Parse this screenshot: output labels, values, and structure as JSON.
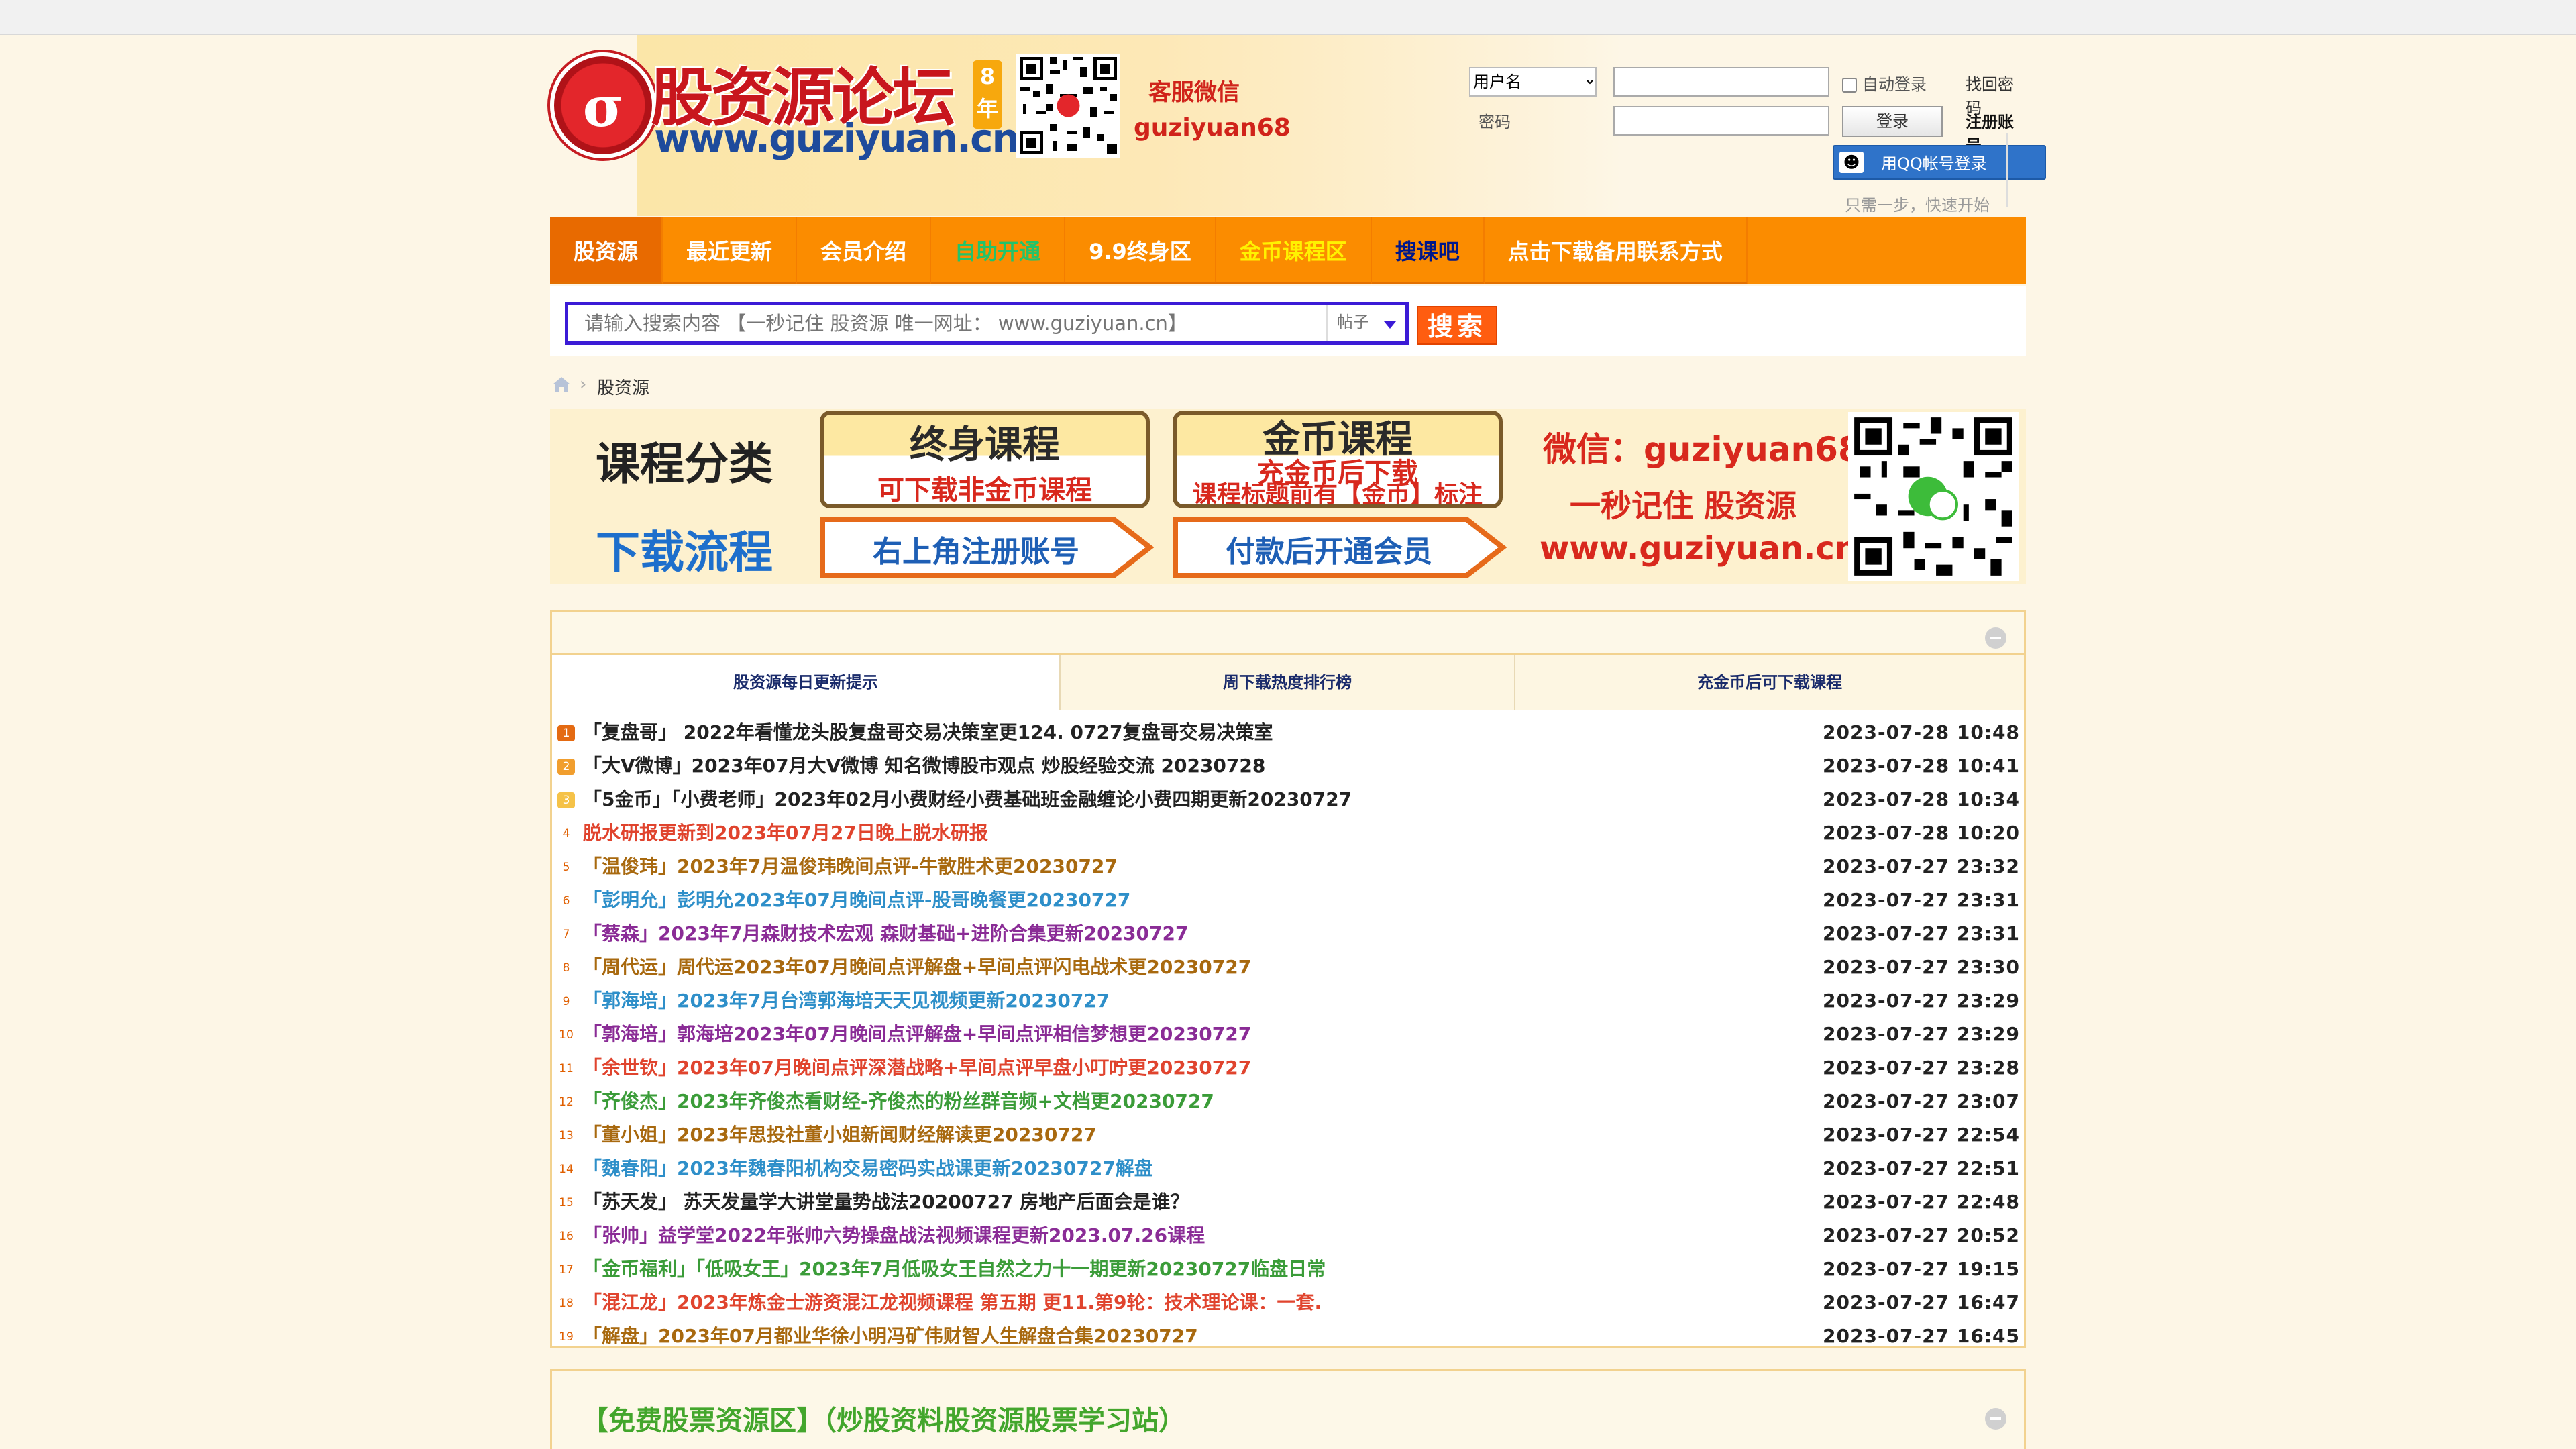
{
  "site": {
    "logo_text": "股资源论坛",
    "logo_url": "www.guziyuan.cn",
    "logo_years": "8年",
    "kefu_label": "客服微信",
    "kefu_id": "guziyuan68"
  },
  "login": {
    "username_option": "用户名",
    "password_label": "密码",
    "auto_login": "自动登录",
    "forgot": "找回密码",
    "login_btn": "登录",
    "register": "注册账号",
    "qq_login": "用QQ帐号登录",
    "hint": "只需一步，快速开始"
  },
  "nav": {
    "items": [
      {
        "label": "股资源"
      },
      {
        "label": "最近更新"
      },
      {
        "label": "会员介绍"
      },
      {
        "label": "自助开通"
      },
      {
        "label": "9.9终身区"
      },
      {
        "label": "金币课程区"
      },
      {
        "label": "搜课吧"
      },
      {
        "label": "点击下载备用联系方式"
      }
    ]
  },
  "search": {
    "placeholder": "请输入搜索内容 【一秒记住 股资源 唯一网址： www.guziyuan.cn】",
    "type": "帖子",
    "button": "搜索"
  },
  "breadcrumb": {
    "current": "股资源"
  },
  "banner": {
    "category": "课程分类",
    "flow": "下载流程",
    "box1_title": "终身课程",
    "box1_sub": "可下载非金币课程",
    "box2_title": "金币课程",
    "box2_mid": "充金币后下载",
    "box2_sub": "课程标题前有【金币】标注",
    "arrow1": "右上角注册账号",
    "arrow2": "付款后开通会员",
    "wechat": "微信：guziyuan68",
    "remember": "一秒记住 股资源",
    "url": "www.guziyuan.cn"
  },
  "panel": {
    "tabs": [
      "股资源每日更新提示",
      "周下载热度排行榜",
      "充金币后可下载课程"
    ],
    "rows": [
      {
        "num": "1",
        "title": "「复盘哥」 2022年看懂龙头股复盘哥交易决策室更124. 0727复盘哥交易决策室",
        "date": "2023-07-28 10:48",
        "color": "#222222"
      },
      {
        "num": "2",
        "title": "「大V微博」2023年07月大V微博 知名微博股市观点 炒股经验交流 20230728",
        "date": "2023-07-28 10:41",
        "color": "#222222"
      },
      {
        "num": "3",
        "title": "「5金币」「小费老师」2023年02月小费财经小费基础班金融缠论小费四期更新20230727",
        "date": "2023-07-28 10:34",
        "color": "#222222"
      },
      {
        "num": "4",
        "title": "脱水研报更新到2023年07月27日晚上脱水研报",
        "date": "2023-07-28 10:20",
        "color": "#e0442e"
      },
      {
        "num": "5",
        "title": "「温俊玮」2023年7月温俊玮晚间点评-牛散胜术更20230727",
        "date": "2023-07-27 23:32",
        "color": "#a8690f"
      },
      {
        "num": "6",
        "title": "「彭明允」彭明允2023年07月晚间点评-股哥晚餐更20230727",
        "date": "2023-07-27 23:31",
        "color": "#2e8fc9"
      },
      {
        "num": "7",
        "title": "「蔡森」2023年7月森财技术宏观 森财基础+进阶合集更新20230727",
        "date": "2023-07-27 23:31",
        "color": "#8a2c96"
      },
      {
        "num": "8",
        "title": "「周代运」周代运2023年07月晚间点评解盘+早间点评闪电战术更20230727",
        "date": "2023-07-27 23:30",
        "color": "#a8690f"
      },
      {
        "num": "9",
        "title": "「郭海培」2023年7月台湾郭海培天天见视频更新20230727",
        "date": "2023-07-27 23:29",
        "color": "#2e8fc9"
      },
      {
        "num": "10",
        "title": "「郭海培」郭海培2023年07月晚间点评解盘+早间点评相信梦想更20230727",
        "date": "2023-07-27 23:29",
        "color": "#8a2c96"
      },
      {
        "num": "11",
        "title": "「余世钦」2023年07月晚间点评深潜战略+早间点评早盘小叮咛更20230727",
        "date": "2023-07-27 23:28",
        "color": "#e0442e"
      },
      {
        "num": "12",
        "title": "「齐俊杰」2023年齐俊杰看财经-齐俊杰的粉丝群音频+文档更20230727",
        "date": "2023-07-27 23:07",
        "color": "#3b9c39"
      },
      {
        "num": "13",
        "title": "「董小姐」2023年思投社董小姐新闻财经解读更20230727",
        "date": "2023-07-27 22:54",
        "color": "#a8690f"
      },
      {
        "num": "14",
        "title": "「魏春阳」2023年魏春阳机构交易密码实战课更新20230727解盘",
        "date": "2023-07-27 22:51",
        "color": "#2e8fc9"
      },
      {
        "num": "15",
        "title": "「苏天发」 苏天发量学大讲堂量势战法20200727 房地产后面会是谁？",
        "date": "2023-07-27 22:48",
        "color": "#222222"
      },
      {
        "num": "16",
        "title": "「张帅」益学堂2022年张帅六势操盘战法视频课程更新2023.07.26课程",
        "date": "2023-07-27 20:52",
        "color": "#8a2c96"
      },
      {
        "num": "17",
        "title": "「金币福利」「低吸女王」2023年7月低吸女王自然之力十一期更新20230727临盘日常",
        "date": "2023-07-27 19:15",
        "color": "#3b9c39"
      },
      {
        "num": "18",
        "title": "「混江龙」2023年炼金士游资混江龙视频课程 第五期 更11.第9轮：技术理论课：一套.",
        "date": "2023-07-27 16:47",
        "color": "#e0442e"
      },
      {
        "num": "19",
        "title": "「解盘」2023年07月都业华徐小明冯矿伟财智人生解盘合集20230727",
        "date": "2023-07-27 16:45",
        "color": "#a8690f"
      }
    ]
  },
  "panel2": {
    "title": "【免费股票资源区】（炒股资料股资源股票学习站）"
  }
}
